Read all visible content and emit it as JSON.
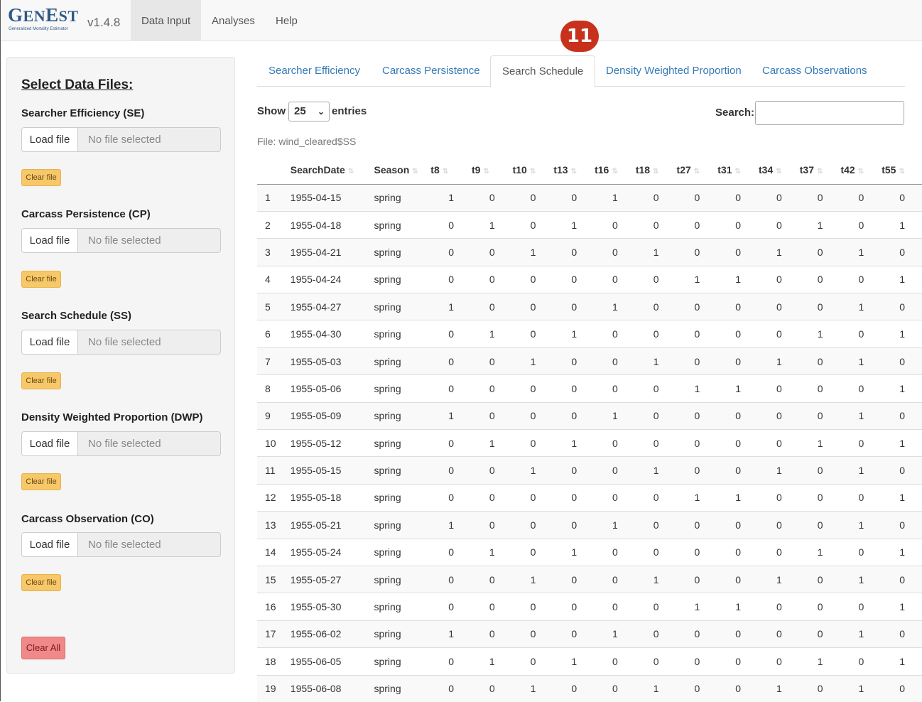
{
  "brand": {
    "logo_big": "GenEst",
    "subtitle": "Generalized Mortality Estimator",
    "version": "v1.4.8"
  },
  "nav": [
    "Data Input",
    "Analyses",
    "Help"
  ],
  "badge": "11",
  "sidebar": {
    "title": "Select Data Files:",
    "load_label": "Load file",
    "no_file": "No file selected",
    "clear_label": "Clear file",
    "clear_all": "Clear All",
    "groups": [
      "Searcher Efficiency (SE)",
      "Carcass Persistence (CP)",
      "Search Schedule (SS)",
      "Density Weighted Proportion (DWP)",
      "Carcass Observation (CO)"
    ]
  },
  "tabs": [
    "Searcher Efficiency",
    "Carcass Persistence",
    "Search Schedule",
    "Density Weighted Proportion",
    "Carcass Observations"
  ],
  "controls": {
    "show": "Show",
    "entries_value": "25",
    "entries": "entries",
    "search": "Search:",
    "file": "File: wind_cleared$SS"
  },
  "table": {
    "columns": [
      "",
      "SearchDate",
      "Season",
      "t8",
      "t9",
      "t10",
      "t13",
      "t16",
      "t18",
      "t27",
      "t31",
      "t34",
      "t37",
      "t42",
      "t55"
    ],
    "rows": [
      [
        "1",
        "1955-04-15",
        "spring",
        "1",
        "0",
        "0",
        "0",
        "1",
        "0",
        "0",
        "0",
        "0",
        "0",
        "0",
        "0"
      ],
      [
        "2",
        "1955-04-18",
        "spring",
        "0",
        "1",
        "0",
        "1",
        "0",
        "0",
        "0",
        "0",
        "0",
        "1",
        "0",
        "1"
      ],
      [
        "3",
        "1955-04-21",
        "spring",
        "0",
        "0",
        "1",
        "0",
        "0",
        "1",
        "0",
        "0",
        "1",
        "0",
        "1",
        "0"
      ],
      [
        "4",
        "1955-04-24",
        "spring",
        "0",
        "0",
        "0",
        "0",
        "0",
        "0",
        "1",
        "1",
        "0",
        "0",
        "0",
        "1"
      ],
      [
        "5",
        "1955-04-27",
        "spring",
        "1",
        "0",
        "0",
        "0",
        "1",
        "0",
        "0",
        "0",
        "0",
        "0",
        "1",
        "0"
      ],
      [
        "6",
        "1955-04-30",
        "spring",
        "0",
        "1",
        "0",
        "1",
        "0",
        "0",
        "0",
        "0",
        "0",
        "1",
        "0",
        "1"
      ],
      [
        "7",
        "1955-05-03",
        "spring",
        "0",
        "0",
        "1",
        "0",
        "0",
        "1",
        "0",
        "0",
        "1",
        "0",
        "1",
        "0"
      ],
      [
        "8",
        "1955-05-06",
        "spring",
        "0",
        "0",
        "0",
        "0",
        "0",
        "0",
        "1",
        "1",
        "0",
        "0",
        "0",
        "1"
      ],
      [
        "9",
        "1955-05-09",
        "spring",
        "1",
        "0",
        "0",
        "0",
        "1",
        "0",
        "0",
        "0",
        "0",
        "0",
        "1",
        "0"
      ],
      [
        "10",
        "1955-05-12",
        "spring",
        "0",
        "1",
        "0",
        "1",
        "0",
        "0",
        "0",
        "0",
        "0",
        "1",
        "0",
        "1"
      ],
      [
        "11",
        "1955-05-15",
        "spring",
        "0",
        "0",
        "1",
        "0",
        "0",
        "1",
        "0",
        "0",
        "1",
        "0",
        "1",
        "0"
      ],
      [
        "12",
        "1955-05-18",
        "spring",
        "0",
        "0",
        "0",
        "0",
        "0",
        "0",
        "1",
        "1",
        "0",
        "0",
        "0",
        "1"
      ],
      [
        "13",
        "1955-05-21",
        "spring",
        "1",
        "0",
        "0",
        "0",
        "1",
        "0",
        "0",
        "0",
        "0",
        "0",
        "1",
        "0"
      ],
      [
        "14",
        "1955-05-24",
        "spring",
        "0",
        "1",
        "0",
        "1",
        "0",
        "0",
        "0",
        "0",
        "0",
        "1",
        "0",
        "1"
      ],
      [
        "15",
        "1955-05-27",
        "spring",
        "0",
        "0",
        "1",
        "0",
        "0",
        "1",
        "0",
        "0",
        "1",
        "0",
        "1",
        "0"
      ],
      [
        "16",
        "1955-05-30",
        "spring",
        "0",
        "0",
        "0",
        "0",
        "0",
        "0",
        "1",
        "1",
        "0",
        "0",
        "0",
        "1"
      ],
      [
        "17",
        "1955-06-02",
        "spring",
        "1",
        "0",
        "0",
        "0",
        "1",
        "0",
        "0",
        "0",
        "0",
        "0",
        "1",
        "0"
      ],
      [
        "18",
        "1955-06-05",
        "spring",
        "0",
        "1",
        "0",
        "1",
        "0",
        "0",
        "0",
        "0",
        "0",
        "1",
        "0",
        "1"
      ],
      [
        "19",
        "1955-06-08",
        "spring",
        "0",
        "0",
        "1",
        "0",
        "0",
        "1",
        "0",
        "0",
        "1",
        "0",
        "1",
        "0"
      ]
    ]
  }
}
